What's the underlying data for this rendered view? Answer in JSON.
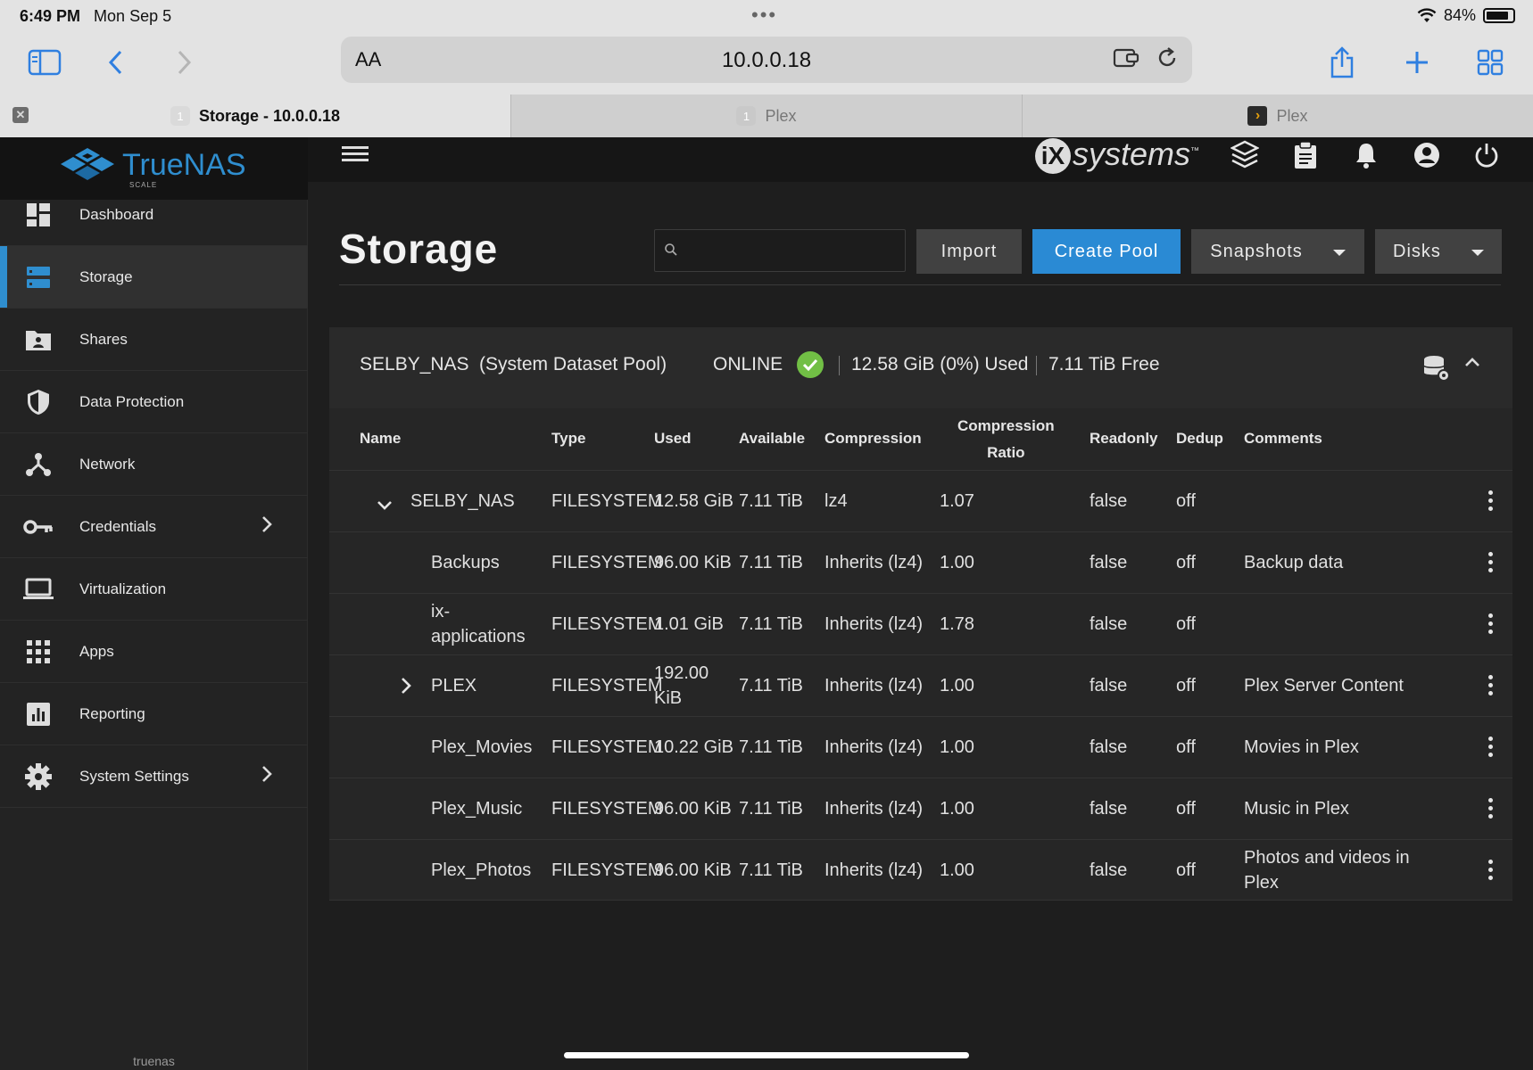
{
  "status_bar": {
    "time": "6:49 PM",
    "date": "Mon Sep 5",
    "battery": "84%",
    "battery_level": 0.84
  },
  "browser": {
    "aa_label": "AA",
    "url": "10.0.0.18",
    "tabs": [
      {
        "badge": "1",
        "title": "Storage - 10.0.0.18",
        "active": true
      },
      {
        "badge": "1",
        "title": "Plex",
        "active": false
      },
      {
        "badge": "›",
        "title": "Plex",
        "active": false
      }
    ]
  },
  "brand": {
    "name": "TrueNAS",
    "edition": "SCALE",
    "vendor_mark": "iX",
    "vendor_text": "systems",
    "vendor_tm": "™"
  },
  "sidebar": {
    "items": [
      {
        "label": "Dashboard",
        "icon": "dashboard-icon"
      },
      {
        "label": "Storage",
        "icon": "storage-icon",
        "active": true
      },
      {
        "label": "Shares",
        "icon": "shares-folder-icon"
      },
      {
        "label": "Data Protection",
        "icon": "shield-icon"
      },
      {
        "label": "Network",
        "icon": "network-icon"
      },
      {
        "label": "Credentials",
        "icon": "key-icon",
        "has_children": true
      },
      {
        "label": "Virtualization",
        "icon": "laptop-icon"
      },
      {
        "label": "Apps",
        "icon": "apps-grid-icon"
      },
      {
        "label": "Reporting",
        "icon": "reporting-chart-icon"
      },
      {
        "label": "System Settings",
        "icon": "gear-icon",
        "has_children": true
      }
    ],
    "hostname": "truenas"
  },
  "page": {
    "title": "Storage",
    "search_placeholder": "",
    "buttons": {
      "import": "Import",
      "create_pool": "Create Pool",
      "snapshots": "Snapshots",
      "disks": "Disks"
    }
  },
  "pool": {
    "name": "SELBY_NAS",
    "role": "(System Dataset Pool)",
    "status": "ONLINE",
    "used": "12.58 GiB (0%) Used",
    "free": "7.11 TiB Free",
    "divider": "|"
  },
  "table": {
    "headers": {
      "name": "Name",
      "type": "Type",
      "used": "Used",
      "available": "Available",
      "compression": "Compression",
      "ratio_1": "Compression",
      "ratio_2": "Ratio",
      "readonly": "Readonly",
      "dedup": "Dedup",
      "comments": "Comments"
    },
    "rows": [
      {
        "name": "SELBY_NAS",
        "name_line2": "",
        "type": "FILESYSTEM",
        "used": "12.58 GiB",
        "used_line2": "",
        "available": "7.11 TiB",
        "compression": "lz4",
        "ratio": "1.07",
        "readonly": "false",
        "dedup": "off",
        "comments": "",
        "comments_line2": ""
      },
      {
        "name": "Backups",
        "name_line2": "",
        "type": "FILESYSTEM",
        "used": "96.00 KiB",
        "used_line2": "",
        "available": "7.11 TiB",
        "compression": "Inherits (lz4)",
        "ratio": "1.00",
        "readonly": "false",
        "dedup": "off",
        "comments": "Backup data",
        "comments_line2": ""
      },
      {
        "name": "ix-",
        "name_line2": "applications",
        "type": "FILESYSTEM",
        "used": "1.01 GiB",
        "used_line2": "",
        "available": "7.11 TiB",
        "compression": "Inherits (lz4)",
        "ratio": "1.78",
        "readonly": "false",
        "dedup": "off",
        "comments": "",
        "comments_line2": ""
      },
      {
        "name": "PLEX",
        "name_line2": "",
        "type": "FILESYSTEM",
        "used": "192.00",
        "used_line2": "KiB",
        "available": "7.11 TiB",
        "compression": "Inherits (lz4)",
        "ratio": "1.00",
        "readonly": "false",
        "dedup": "off",
        "comments": "Plex Server Content",
        "comments_line2": ""
      },
      {
        "name": "Plex_Movies",
        "name_line2": "",
        "type": "FILESYSTEM",
        "used": "10.22 GiB",
        "used_line2": "",
        "available": "7.11 TiB",
        "compression": "Inherits (lz4)",
        "ratio": "1.00",
        "readonly": "false",
        "dedup": "off",
        "comments": "Movies in Plex",
        "comments_line2": ""
      },
      {
        "name": "Plex_Music",
        "name_line2": "",
        "type": "FILESYSTEM",
        "used": "96.00 KiB",
        "used_line2": "",
        "available": "7.11 TiB",
        "compression": "Inherits (lz4)",
        "ratio": "1.00",
        "readonly": "false",
        "dedup": "off",
        "comments": "Music in Plex",
        "comments_line2": ""
      },
      {
        "name": "Plex_Photos",
        "name_line2": "",
        "type": "FILESYSTEM",
        "used": "96.00 KiB",
        "used_line2": "",
        "available": "7.11 TiB",
        "compression": "Inherits (lz4)",
        "ratio": "1.00",
        "readonly": "false",
        "dedup": "off",
        "comments": "Photos and videos in",
        "comments_line2": "Plex"
      }
    ]
  },
  "colors": {
    "accent": "#2a8ad4",
    "online": "#71bf45",
    "background": "#1e1e1e",
    "sidebar": "#232323"
  }
}
